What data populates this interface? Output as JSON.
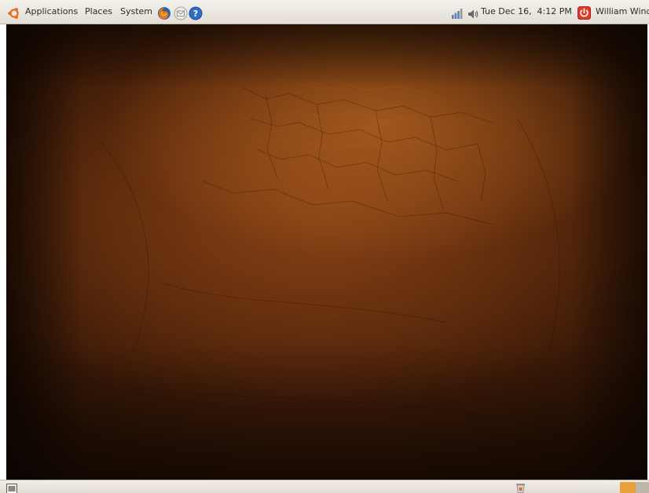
{
  "top_panel": {
    "menus": {
      "applications": "Applications",
      "places": "Places",
      "system": "System"
    },
    "launchers": [
      "firefox-icon",
      "mail-icon",
      "help-icon"
    ],
    "tray": {
      "icons": [
        "network-signal-icon",
        "volume-icon"
      ],
      "clock": "Tue Dec 16,  4:12 PM",
      "user": "William Windsor"
    }
  },
  "bottom_panel": {
    "icons": [
      "show-desktop-icon",
      "trash-icon"
    ],
    "workspaces": [
      {
        "name": "workspace-1",
        "active": true
      },
      {
        "name": "workspace-2",
        "active": false
      }
    ]
  },
  "colors": {
    "panel": "#e6e2da",
    "wallpaper_dark": "#2a1205",
    "wallpaper_mid": "#6e3512",
    "wallpaper_highlight": "#d2782a",
    "workspace_active": "#e8a13a",
    "workspace_inactive": "#bdb7ab"
  }
}
